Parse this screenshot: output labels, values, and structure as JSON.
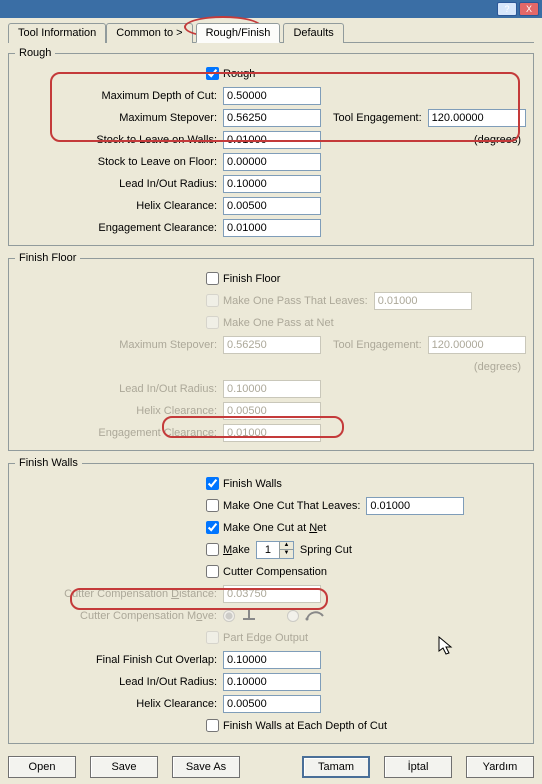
{
  "tabs": {
    "tool_information": "Tool Information",
    "common_to": "Common to >",
    "rough_finish": "Rough/Finish",
    "defaults": "Defaults"
  },
  "rough": {
    "legend": "Rough",
    "enable_label": "Rough",
    "enable": true,
    "max_depth_label": "Maximum Depth of Cut:",
    "max_depth": "0.50000",
    "max_stepover_label": "Maximum Stepover:",
    "max_stepover": "0.56250",
    "tool_engagement_label": "Tool Engagement:",
    "tool_engagement": "120.00000",
    "degrees": "(degrees)",
    "stock_walls_label": "Stock to Leave on Walls:",
    "stock_walls": "0.01000",
    "stock_floor_label": "Stock to Leave on Floor:",
    "stock_floor": "0.00000",
    "lead_radius_label": "Lead In/Out Radius:",
    "lead_radius": "0.10000",
    "helix_label": "Helix Clearance:",
    "helix": "0.00500",
    "engagement_clr_label": "Engagement Clearance:",
    "engagement_clr": "0.01000"
  },
  "finish_floor": {
    "legend": "Finish Floor",
    "enable_label": "Finish Floor",
    "enable": false,
    "one_pass_leaves_label": "Make One Pass That Leaves:",
    "one_pass_leaves": "0.01000",
    "one_pass_net_label": "Make One Pass at Net",
    "max_stepover_label": "Maximum Stepover:",
    "max_stepover": "0.56250",
    "tool_engagement_label": "Tool Engagement:",
    "tool_engagement": "120.00000",
    "degrees": "(degrees)",
    "lead_radius_label": "Lead In/Out Radius:",
    "lead_radius": "0.10000",
    "helix_label": "Helix Clearance:",
    "helix": "0.00500",
    "engagement_clr_label": "Engagement Clearance:",
    "engagement_clr": "0.01000"
  },
  "finish_walls": {
    "legend": "Finish Walls",
    "enable_label": "Finish Walls",
    "enable": true,
    "one_cut_leaves_label": "Make One Cut That Leaves:",
    "one_cut_leaves_checked": false,
    "one_cut_leaves": "0.01000",
    "one_cut_net_label_pre": "Make One Cut at ",
    "one_cut_net_label_underline": "N",
    "one_cut_net_label_post": "et",
    "one_cut_net": true,
    "make_label_underline": "M",
    "make_label_post": "ake",
    "make_count": "1",
    "make_checked": false,
    "spring_cut": "Spring Cut",
    "cutter_comp_label": "Cutter Compensation",
    "cutter_comp": false,
    "ccd_label_pre": "Cutter Compensation ",
    "ccd_underline": "D",
    "ccd_post": "istance:",
    "ccd": "0.03750",
    "ccm_label_pre": "Cutter Compensation M",
    "ccm_underline": "o",
    "ccm_post": "ve:",
    "part_edge_label": "Part Edge Output",
    "overlap_label": "Final Finish Cut Overlap:",
    "overlap": "0.10000",
    "lead_radius_label": "Lead In/Out Radius:",
    "lead_radius": "0.10000",
    "helix_label": "Helix Clearance:",
    "helix": "0.00500",
    "each_depth_label": "Finish Walls at Each Depth of Cut",
    "each_depth": false
  },
  "buttons": {
    "open": "Open",
    "save": "Save",
    "save_as": "Save As",
    "ok": "Tamam",
    "cancel": "İptal",
    "help": "Yardım"
  }
}
